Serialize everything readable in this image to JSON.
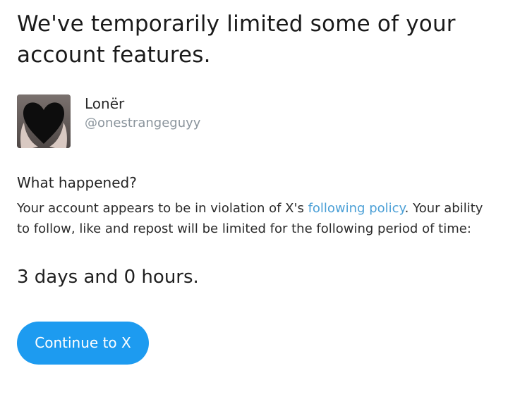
{
  "headline": "We've temporarily limited some of your account features.",
  "profile": {
    "display_name": "Lonër",
    "handle": "@onestrangeguyy"
  },
  "what_happened": {
    "title": "What happened?",
    "text_before_link": "Your account appears to be in violation of X's ",
    "link_label": "following policy",
    "text_after_link": ". Your ability to follow, like and repost will be limited for the following period of time:"
  },
  "duration": "3 days and 0 hours.",
  "continue_button": {
    "label": "Continue to X"
  },
  "colors": {
    "accent": "#1d9bf0",
    "link": "#4a9fd6",
    "handle": "#8a949c"
  }
}
